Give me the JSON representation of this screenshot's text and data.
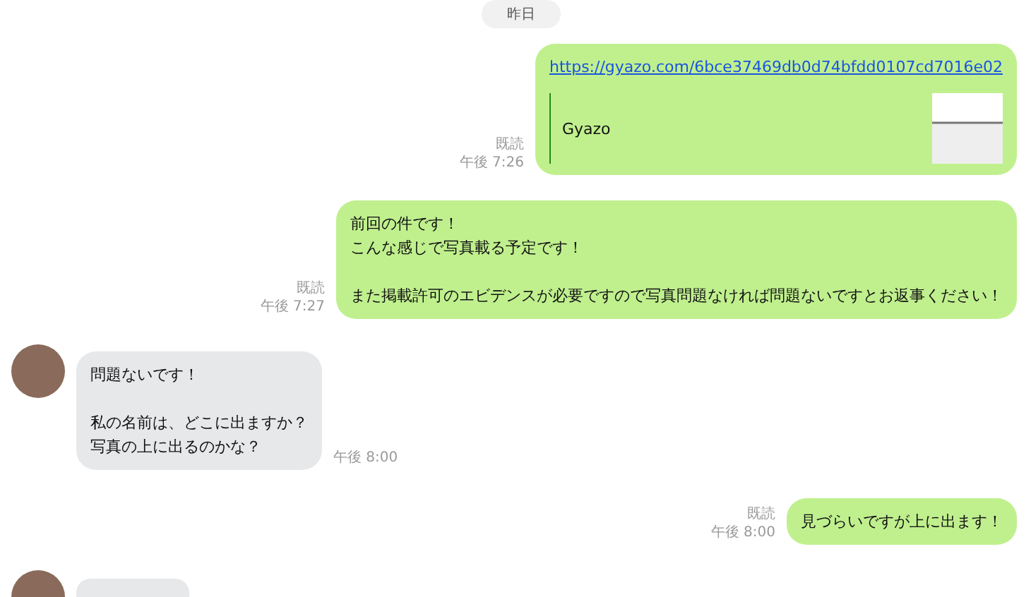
{
  "date_divider": "昨日",
  "messages": [
    {
      "kind": "link",
      "outgoing": true,
      "read_receipt": "既読",
      "time": "午後 7:26",
      "url": "https://gyazo.com/6bce37469db0d74bfdd0107cd7016e02",
      "preview_title": "Gyazo"
    },
    {
      "kind": "text",
      "outgoing": true,
      "read_receipt": "既読",
      "time": "午後 7:27",
      "paragraphs": [
        [
          "前回の件です！",
          "こんな感じで写真載る予定です！"
        ],
        [
          "また掲載許可のエビデンスが必要ですので写真問題なければ問題ないですとお返事ください！"
        ]
      ]
    },
    {
      "kind": "text",
      "outgoing": false,
      "time": "午後 8:00",
      "paragraphs": [
        [
          "問題ないです！"
        ],
        [
          "私の名前は、どこに出ますか？",
          "写真の上に出るのかな？"
        ]
      ]
    },
    {
      "kind": "text",
      "outgoing": true,
      "read_receipt": "既読",
      "time": "午後 8:00",
      "paragraphs": [
        [
          "見づらいですが上に出ます！"
        ]
      ]
    },
    {
      "kind": "partial",
      "outgoing": false
    }
  ]
}
